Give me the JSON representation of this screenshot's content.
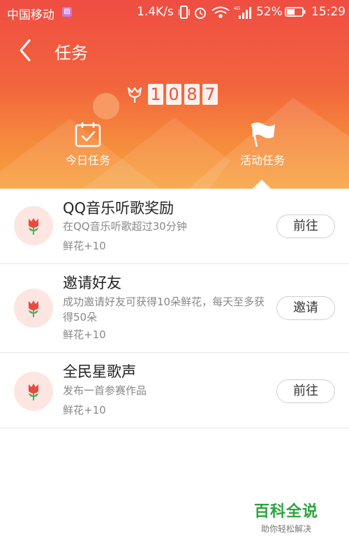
{
  "status_bar": {
    "carrier": "中国移动",
    "net_speed": "1.4K/s",
    "network_type": "4G",
    "battery": "52%",
    "time": "15:29"
  },
  "header": {
    "title": "任务",
    "flower_count": [
      "1",
      "0",
      "8",
      "7"
    ]
  },
  "tabs": [
    {
      "label": "今日任务",
      "icon": "calendar-check-icon",
      "active": false
    },
    {
      "label": "活动任务",
      "icon": "flag-icon",
      "active": true
    }
  ],
  "tasks": [
    {
      "title": "QQ音乐听歌奖励",
      "desc": "在QQ音乐听歌超过30分钟",
      "reward": "鲜花+10",
      "button": "前往",
      "icon": "flower-icon"
    },
    {
      "title": "邀请好友",
      "desc": "成功邀请好友可获得10朵鲜花，每天至多获得50朵",
      "reward": "鲜花+10",
      "button": "邀请",
      "icon": "flower-icon"
    },
    {
      "title": "全民星歌声",
      "desc": "发布一首参赛作品",
      "reward": "鲜花+10",
      "button": "前往",
      "icon": "flower-icon"
    }
  ],
  "watermark": {
    "title": "百科全说",
    "subtitle": "助你轻松解决"
  },
  "colors": {
    "header_top": "#ef4d42",
    "header_bottom": "#f7a23f",
    "flower_red": "#e84b3c",
    "leaf_green": "#43b35a",
    "avatar_bg": "#fde5e2",
    "watermark_green": "#2aa53a"
  }
}
